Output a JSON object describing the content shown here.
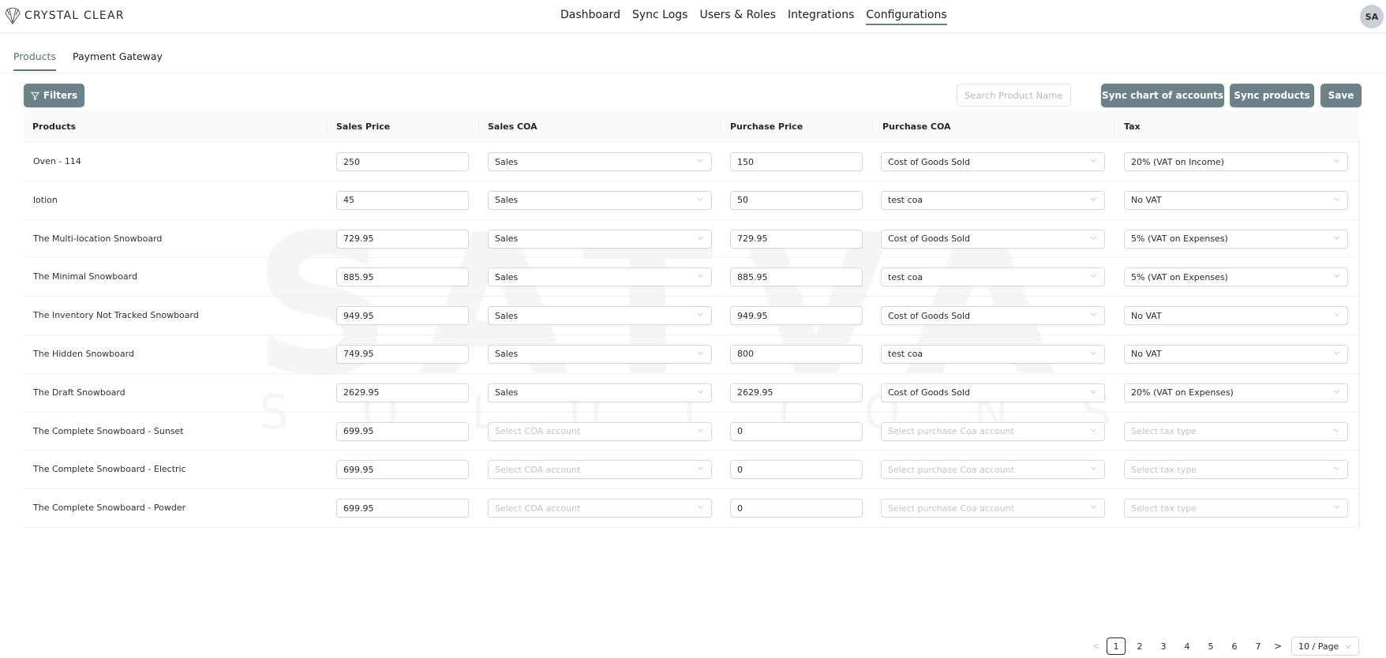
{
  "header": {
    "brand": "CRYSTAL CLEAR",
    "nav": [
      {
        "label": "Dashboard",
        "active": false
      },
      {
        "label": "Sync Logs",
        "active": false
      },
      {
        "label": "Users & Roles",
        "active": false
      },
      {
        "label": "Integrations",
        "active": false
      },
      {
        "label": "Configurations",
        "active": true
      }
    ],
    "avatar_initials": "SA"
  },
  "subtabs": [
    {
      "label": "Products",
      "active": true
    },
    {
      "label": "Payment Gateway",
      "active": false
    }
  ],
  "toolbar": {
    "filters_label": "Filters",
    "search_placeholder": "Search Product Name",
    "search_value": "",
    "sync_coa_label": "Sync chart of accounts",
    "sync_products_label": "Sync products",
    "save_label": "Save"
  },
  "watermark": {
    "line1": "SATVA",
    "line2": "SOLUTIONS"
  },
  "table": {
    "columns": [
      "Products",
      "Sales Price",
      "Sales COA",
      "Purchase Price",
      "Purchase COA",
      "Tax"
    ],
    "placeholders": {
      "sales_coa": "Select COA account",
      "purchase_coa": "Select purchase Coa account",
      "tax": "Select tax type"
    },
    "rows": [
      {
        "product": "Oven - 114",
        "sales_price": "250",
        "sales_coa": "Sales",
        "purchase_price": "150",
        "purchase_coa": "Cost of Goods Sold",
        "tax": "20% (VAT on Income)"
      },
      {
        "product": "lotion",
        "sales_price": "45",
        "sales_coa": "Sales",
        "purchase_price": "50",
        "purchase_coa": "test coa",
        "tax": "No VAT"
      },
      {
        "product": "The Multi-location Snowboard",
        "sales_price": "729.95",
        "sales_coa": "Sales",
        "purchase_price": "729.95",
        "purchase_coa": "Cost of Goods Sold",
        "tax": "5% (VAT on Expenses)"
      },
      {
        "product": "The Minimal Snowboard",
        "sales_price": "885.95",
        "sales_coa": "Sales",
        "purchase_price": "885.95",
        "purchase_coa": "test coa",
        "tax": "5% (VAT on Expenses)"
      },
      {
        "product": "The Inventory Not Tracked Snowboard",
        "sales_price": "949.95",
        "sales_coa": "Sales",
        "purchase_price": "949.95",
        "purchase_coa": "Cost of Goods Sold",
        "tax": "No VAT"
      },
      {
        "product": "The Hidden Snowboard",
        "sales_price": "749.95",
        "sales_coa": "Sales",
        "purchase_price": "800",
        "purchase_coa": "test coa",
        "tax": "No VAT"
      },
      {
        "product": "The Draft Snowboard",
        "sales_price": "2629.95",
        "sales_coa": "Sales",
        "purchase_price": "2629.95",
        "purchase_coa": "Cost of Goods Sold",
        "tax": "20% (VAT on Expenses)"
      },
      {
        "product": "The Complete Snowboard - Sunset",
        "sales_price": "699.95",
        "sales_coa": "",
        "purchase_price": "0",
        "purchase_coa": "",
        "tax": ""
      },
      {
        "product": "The Complete Snowboard - Electric",
        "sales_price": "699.95",
        "sales_coa": "",
        "purchase_price": "0",
        "purchase_coa": "",
        "tax": ""
      },
      {
        "product": "The Complete Snowboard - Powder",
        "sales_price": "699.95",
        "sales_coa": "",
        "purchase_price": "0",
        "purchase_coa": "",
        "tax": ""
      }
    ]
  },
  "pagination": {
    "prev_icon": "chevron-left-icon",
    "next_icon": "chevron-right-icon",
    "pages": [
      "1",
      "2",
      "3",
      "4",
      "5",
      "6",
      "7"
    ],
    "current_page": "1",
    "page_size": "10 / Page"
  },
  "icons": {
    "filter": "funnel-icon",
    "dropdown": "chevron-down-icon",
    "logo": "diamond-icon"
  }
}
